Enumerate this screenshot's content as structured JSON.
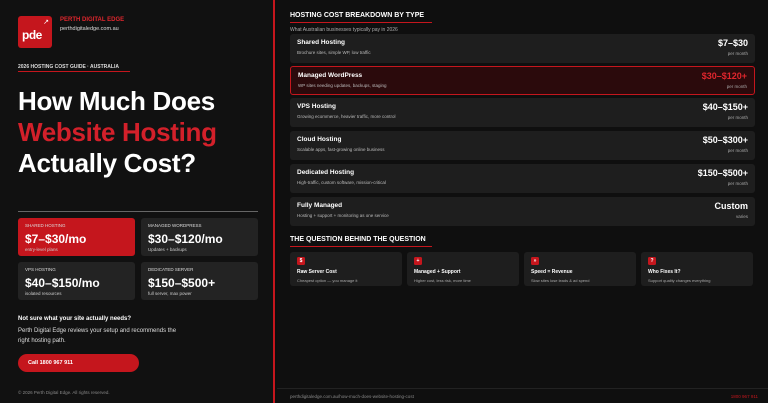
{
  "brand": {
    "logo_text": "pde",
    "name": "PERTH DIGITAL EDGE",
    "url": "perthdigitaledge.com.au",
    "accent_color": "#c5161d"
  },
  "guide_label": "2026 HOSTING COST GUIDE · AUSTRALIA",
  "headline": {
    "line1": "How Much Does",
    "line2": "Website Hosting",
    "line3": "Actually Cost?"
  },
  "quick_cards": [
    {
      "label": "SHARED HOSTING",
      "value": "$7–$30/mo",
      "sub": "entry-level plans"
    },
    {
      "label": "MANAGED WORDPRESS",
      "value": "$30–$120/mo",
      "sub": "Updates + backups"
    },
    {
      "label": "VPS HOSTING",
      "value": "$40–$150/mo",
      "sub": "isolated resources"
    },
    {
      "label": "DEDICATED SERVER",
      "value": "$150–$500+",
      "sub": "full server, max power"
    }
  ],
  "cta": {
    "question": "Not sure what your site actually needs?",
    "description": "Perth Digital Edge reviews your setup and recommends the right hosting path.",
    "button": "Call 1800 967 911"
  },
  "copyright": "© 2026 Perth Digital Edge. All rights reserved.",
  "breakdown": {
    "title": "HOSTING COST BREAKDOWN BY TYPE",
    "subtitle": "What Australian businesses typically pay in 2026",
    "rows": [
      {
        "title": "Shared Hosting",
        "desc": "Brochure sites, simple WP, low traffic",
        "price": "$7–$30",
        "unit": "per month"
      },
      {
        "title": "Managed WordPress",
        "desc": "WP sites needing updates, backups, staging",
        "price": "$30–$120+",
        "unit": "per month"
      },
      {
        "title": "VPS Hosting",
        "desc": "Growing ecommerce, heavier traffic, more control",
        "price": "$40–$150+",
        "unit": "per month"
      },
      {
        "title": "Cloud Hosting",
        "desc": "Scalable apps, fast-growing online business",
        "price": "$50–$300+",
        "unit": "per month"
      },
      {
        "title": "Dedicated Hosting",
        "desc": "High-traffic, custom software, mission-critical",
        "price": "$150–$500+",
        "unit": "per month"
      },
      {
        "title": "Fully Managed",
        "desc": "Hosting + support + monitoring as one service",
        "price": "Custom",
        "unit": "varies"
      }
    ]
  },
  "question": {
    "title": "THE QUESTION BEHIND THE QUESTION",
    "items": [
      {
        "icon": "$",
        "head": "Raw Server Cost",
        "body": "Cheapest option — you manage it"
      },
      {
        "icon": "+",
        "head": "Managed + Support",
        "body": "Higher cost, less risk, more time"
      },
      {
        "icon": "»",
        "head": "Speed = Revenue",
        "body": "Slow sites lose leads & ad spend"
      },
      {
        "icon": "?",
        "head": "Who Fixes It?",
        "body": "Support quality changes everything"
      }
    ]
  },
  "footer": {
    "url": "perthdigitaledge.com.au/how-much-does-website-hosting-cost",
    "phone": "1800 967 911"
  }
}
